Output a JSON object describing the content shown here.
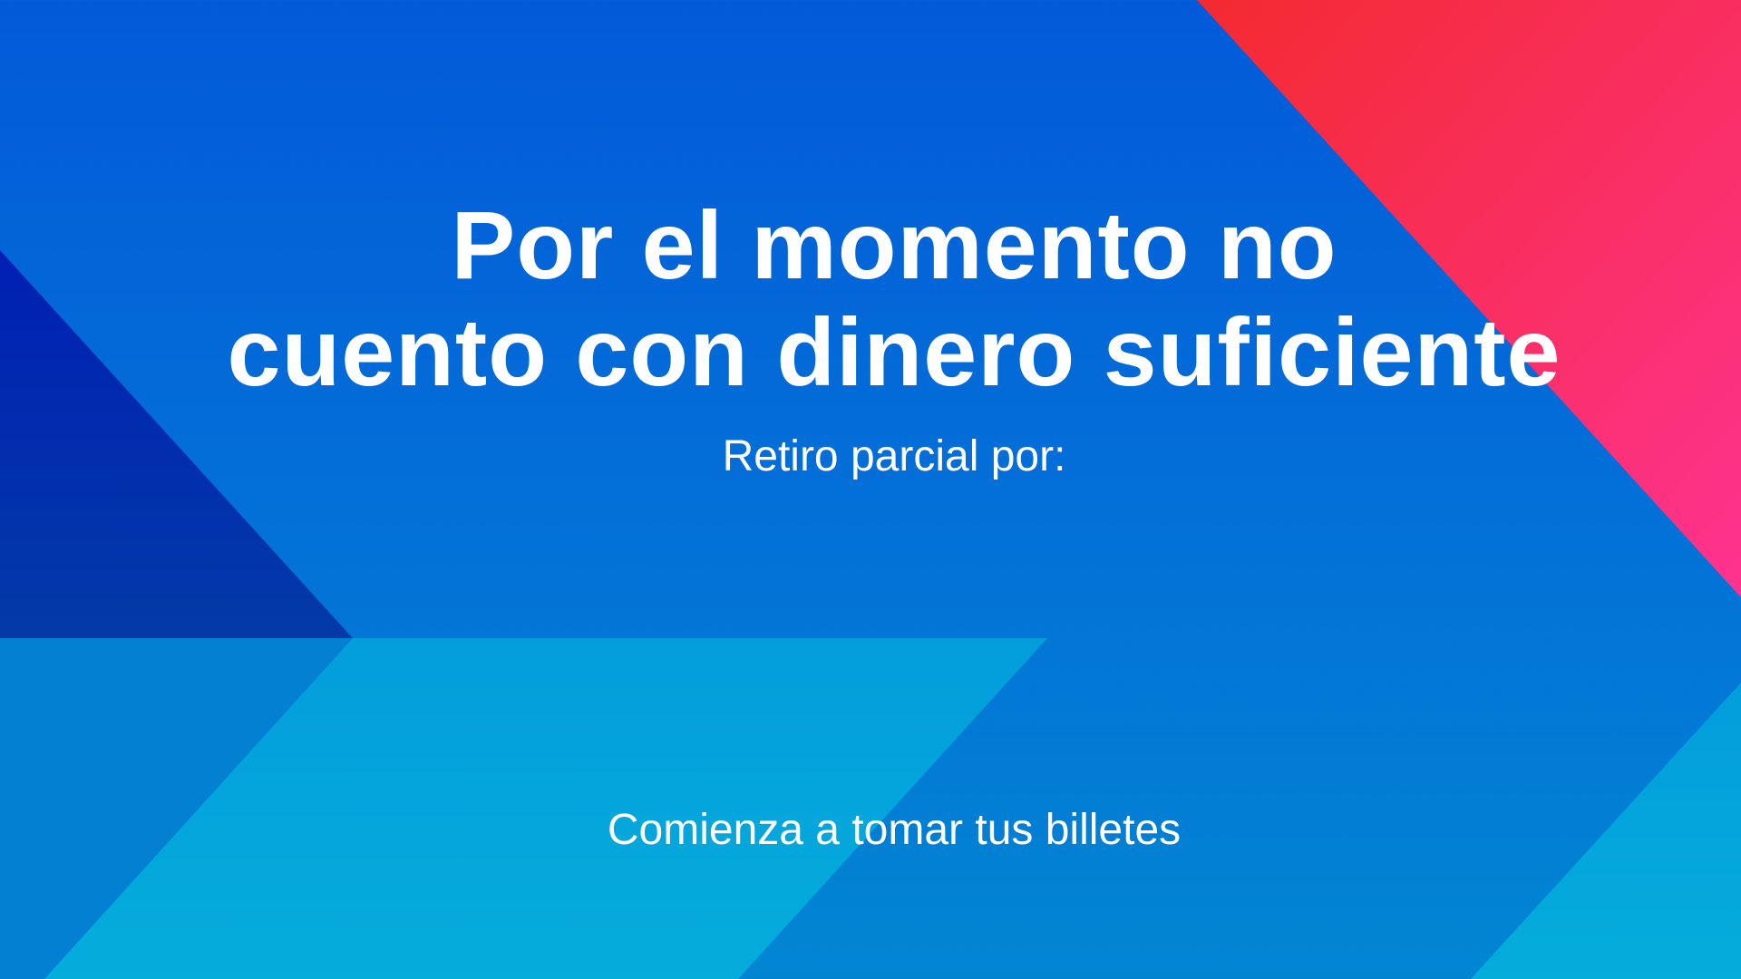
{
  "screen": {
    "title_line1": "Por el momento no",
    "title_line2": "cuento con dinero suficiente",
    "subtitle": "Retiro parcial por:",
    "cta": "Comienza a tomar tus billetes"
  },
  "colors": {
    "background_top": "#035ad9",
    "background_bottom": "#0286d2",
    "accent_red": "#f42a30",
    "accent_pink": "#fe3390",
    "dark_blue": "#0022b0",
    "cyan": "#04a0dc"
  }
}
